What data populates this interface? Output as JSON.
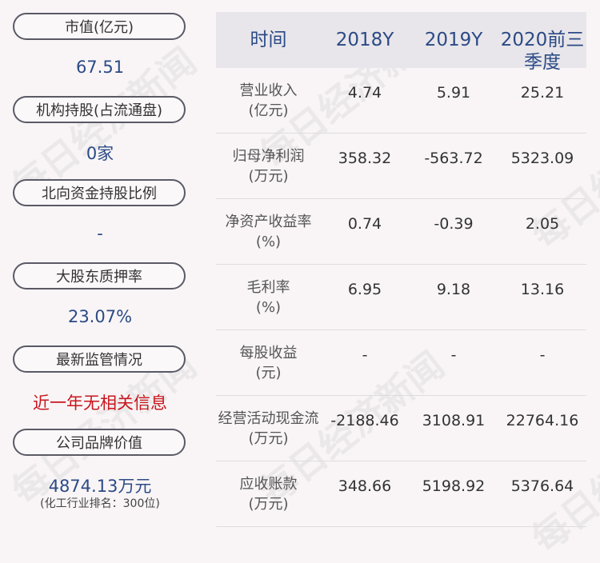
{
  "left_panel": {
    "items": [
      {
        "label": "市值(亿元)",
        "value": "67.51"
      },
      {
        "label": "机构持股(占流通盘)",
        "value": "0家"
      },
      {
        "label": "北向资金持股比例",
        "value": "-"
      },
      {
        "label": "大股东质押率",
        "value": "23.07%"
      },
      {
        "label": "最新监管情况",
        "value": "近一年无相关信息"
      },
      {
        "label": "公司品牌价值",
        "value": "4874.13万元",
        "sub": "(化工行业排名：300位)"
      }
    ]
  },
  "table": {
    "headers": [
      "时间",
      "2018Y",
      "2019Y",
      "2020前三季度"
    ],
    "rows": [
      {
        "label1": "营业收入",
        "label2": "(亿元)",
        "v2018": "4.74",
        "v2019": "5.91",
        "v2020": "25.21"
      },
      {
        "label1": "归母净利润",
        "label2": "(万元)",
        "v2018": "358.32",
        "v2019": "-563.72",
        "v2020": "5323.09"
      },
      {
        "label1": "净资产收益率",
        "label2": "(%)",
        "v2018": "0.74",
        "v2019": "-0.39",
        "v2020": "2.05"
      },
      {
        "label1": "毛利率",
        "label2": "(%)",
        "v2018": "6.95",
        "v2019": "9.18",
        "v2020": "13.16"
      },
      {
        "label1": "每股收益",
        "label2": "(元)",
        "v2018": "-",
        "v2019": "-",
        "v2020": "-"
      },
      {
        "label1": "经营活动现金流",
        "label2": "(万元)",
        "v2018": "-2188.46",
        "v2019": "3108.91",
        "v2020": "22764.16"
      },
      {
        "label1": "应收账款",
        "label2": "(万元)",
        "v2018": "348.66",
        "v2019": "5198.92",
        "v2020": "5376.64"
      }
    ]
  },
  "watermark": "每日经济新闻",
  "colors": {
    "value_blue": "#2b4a86",
    "alert_red": "#c8161d",
    "header_bg": "#e8e6ea"
  }
}
